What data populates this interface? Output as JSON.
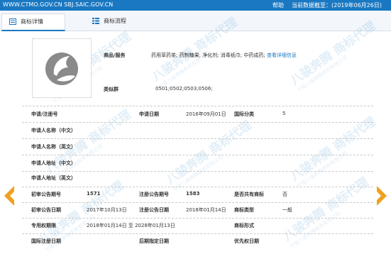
{
  "header": {
    "site": "WWW.CTMO.GOV.CN SBJ.SAIC.GOV.CN",
    "help": "帮助",
    "date": "当前数据截至：(2019年06月26日)"
  },
  "tabs": [
    {
      "label": "商标详情"
    },
    {
      "label": "商标流程"
    }
  ],
  "watermark": {
    "main": "八骏奔腾 商标代理",
    "sub": "宁夏八骏奔腾商务有限公司"
  },
  "goods": {
    "label": "商品/服务",
    "value": "药用草药茶; 药制糖果; 净化剂; 消毒纸巾; 中药成药;",
    "link": "查看详细信息"
  },
  "group": {
    "label": "类似群",
    "value": "0501;0502;0503;0506;"
  },
  "fields": {
    "reg_no_label": "申请/注册号",
    "apply_date_label": "申请日期",
    "apply_date": "2016年09月01日",
    "class_label": "国际分类",
    "class_value": "5",
    "applicant_cn": "申请人名称（中文）",
    "applicant_en": "申请人名称（英文）",
    "address_cn": "申请人地址（中文）",
    "address_en": "申请人地址（英文）",
    "prelim_no_label": "初审公告期号",
    "prelim_no": "1571",
    "reg_pub_no_label": "注册公告期号",
    "reg_pub_no": "1583",
    "shared_label": "是否共有商标",
    "shared_value": "否",
    "prelim_date_label": "初审公告日期",
    "prelim_date": "2017年10月13日",
    "reg_pub_date_label": "注册公告日期",
    "reg_pub_date": "2018年01月14日",
    "type_label": "商标类型",
    "type_value": "一般",
    "exclusive_label": "专用权期限",
    "exclusive_value": "2018年01月14日 至 2028年01月13日",
    "form_label": "商标形式",
    "intl_reg_label": "国际注册日期",
    "later_date_label": "后期指定日期",
    "priority_label": "优先权日期"
  },
  "colors": {
    "accent": "#1a78c2",
    "arrow": "#f0a020",
    "watermark": "#1a78c2"
  }
}
